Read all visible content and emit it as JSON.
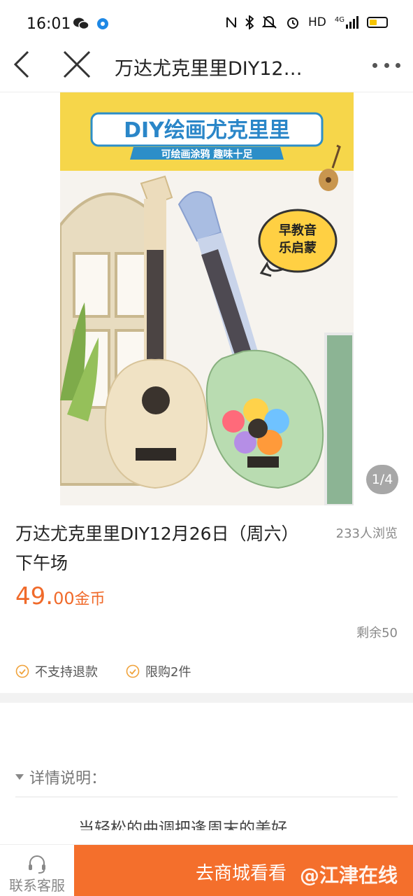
{
  "status_bar": {
    "time": "16:01",
    "hd": "HD",
    "network": "4G",
    "battery_level": 0.45
  },
  "nav": {
    "title": "万达尤克里里DIY12…"
  },
  "product_image": {
    "banner_title": "DIY绘画尤克里里",
    "banner_subtitle": "可绘画涂鸦 趣味十足",
    "badge_line1": "早教音",
    "badge_line2": "乐启蒙",
    "page_indicator": "1/4"
  },
  "product": {
    "title": "万达尤克里里DIY12月26日（周六）下午场",
    "views": "233人浏览",
    "price_int": "49.",
    "price_dec": "00",
    "price_unit": "金币",
    "remaining": "剩余50"
  },
  "tags": [
    {
      "label": "不支持退款"
    },
    {
      "label": "限购2件"
    }
  ],
  "detail": {
    "header": "详情说明：",
    "text": "当轻松的曲调把逢周末的美好"
  },
  "bottom_bar": {
    "service_label": "联系客服",
    "mall_label": "去商城看看",
    "watermark": "@江津在线"
  },
  "colors": {
    "accent": "#f46f2c",
    "price": "#f06a2a",
    "tag_icon": "#f0a33c"
  }
}
